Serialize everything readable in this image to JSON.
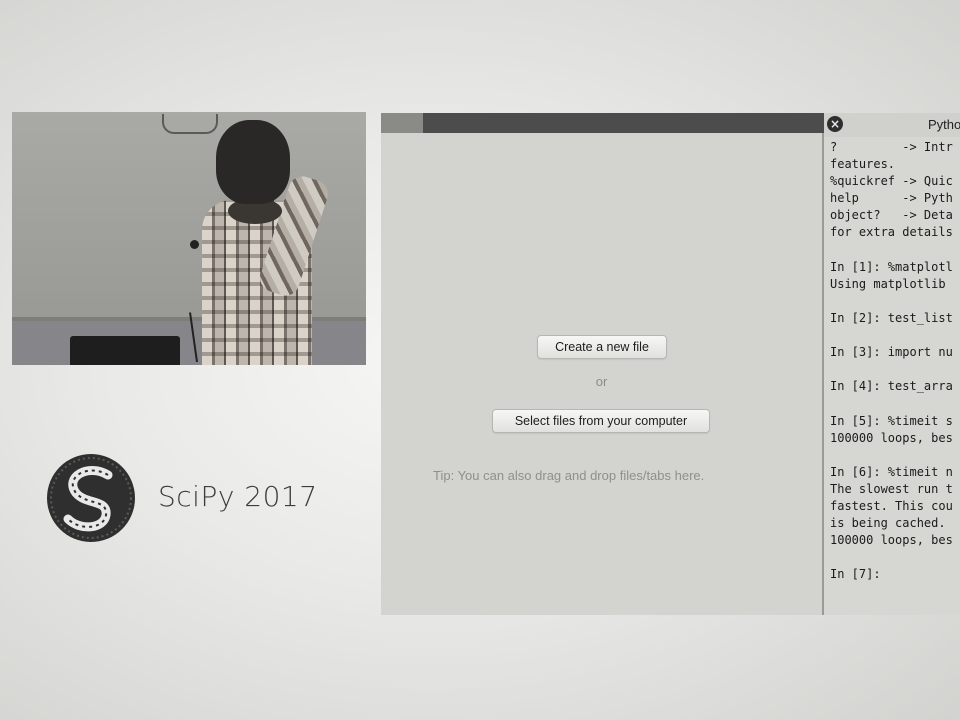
{
  "branding": {
    "logo_text": "SciPy 2017",
    "icon": "scipy-logo-icon"
  },
  "speaker_video": {
    "icon": "speaker-video"
  },
  "launcher": {
    "create_button": "Create a new file",
    "or_label": "or",
    "select_button": "Select files from your computer",
    "tip": "Tip: You can also drag and drop files/tabs here."
  },
  "console": {
    "title": "Pytho",
    "close_icon": "close-icon",
    "lines": [
      "?         -> Intr",
      "features.",
      "%quickref -> Quic",
      "help      -> Pyth",
      "object?   -> Deta",
      "for extra details",
      "",
      "In [1]: %matplotl",
      "Using matplotlib",
      "",
      "In [2]: test_list",
      "",
      "In [3]: import nu",
      "",
      "In [4]: test_arra",
      "",
      "In [5]: %timeit s",
      "100000 loops, bes",
      "",
      "In [6]: %timeit n",
      "The slowest run t",
      "fastest. This cou",
      "is being cached.",
      "100000 loops, bes",
      "",
      "In [7]:"
    ]
  },
  "colors": {
    "tabbar": "#4c4c4c",
    "launcher_bg": "#d3d3cf",
    "console_bg": "#d6d6d2"
  }
}
